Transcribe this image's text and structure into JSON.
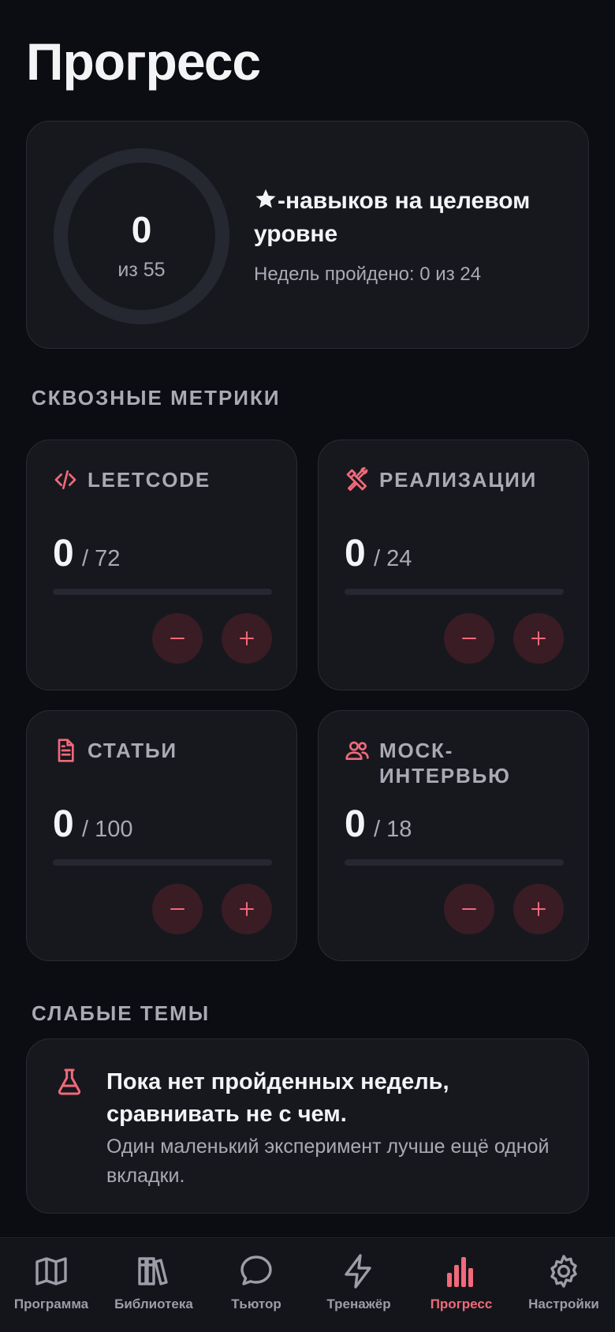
{
  "page_title": "Прогресс",
  "summary": {
    "value": "0",
    "total": "из 55",
    "heading": "-навыков на целевом уровне",
    "star_icon": "star-icon",
    "weeks": "Недель пройдено: 0 из 24",
    "progress_fraction": 0
  },
  "sections": {
    "metrics": "СКВОЗНЫЕ МЕТРИКИ",
    "weak": "СЛАБЫЕ ТЕМЫ"
  },
  "metrics": [
    {
      "title": "LEETCODE",
      "icon": "code-icon",
      "value": "0",
      "total": "/ 72",
      "progress_fraction": 0
    },
    {
      "title": "РЕАЛИЗАЦИИ",
      "icon": "tools-icon",
      "value": "0",
      "total": "/ 24",
      "progress_fraction": 0
    },
    {
      "title": "СТАТЬИ",
      "icon": "document-icon",
      "value": "0",
      "total": "/ 100",
      "progress_fraction": 0
    },
    {
      "title": "МОСК-ИНТЕРВЬЮ",
      "icon": "users-icon",
      "value": "0",
      "total": "/ 18",
      "progress_fraction": 0
    }
  ],
  "step_buttons": {
    "minus": "−",
    "plus": "+"
  },
  "weak_topics": {
    "icon": "flask-icon",
    "title": "Пока нет пройденных недель, сравнивать не с чем.",
    "subtitle": "Один маленький эксперимент лучше ещё одной вкладки."
  },
  "nav": [
    {
      "label": "Программа",
      "icon": "map-icon",
      "active": false
    },
    {
      "label": "Библиотека",
      "icon": "library-icon",
      "active": false
    },
    {
      "label": "Тьютор",
      "icon": "chat-icon",
      "active": false
    },
    {
      "label": "Тренажёр",
      "icon": "bolt-icon",
      "active": false
    },
    {
      "label": "Прогресс",
      "icon": "bar-chart-icon",
      "active": true
    },
    {
      "label": "Настройки",
      "icon": "gear-icon",
      "active": false
    }
  ],
  "colors": {
    "accent": "#f06a7a",
    "background": "#0c0d12",
    "card": "#17181e",
    "muted_text": "#a9aab3"
  }
}
